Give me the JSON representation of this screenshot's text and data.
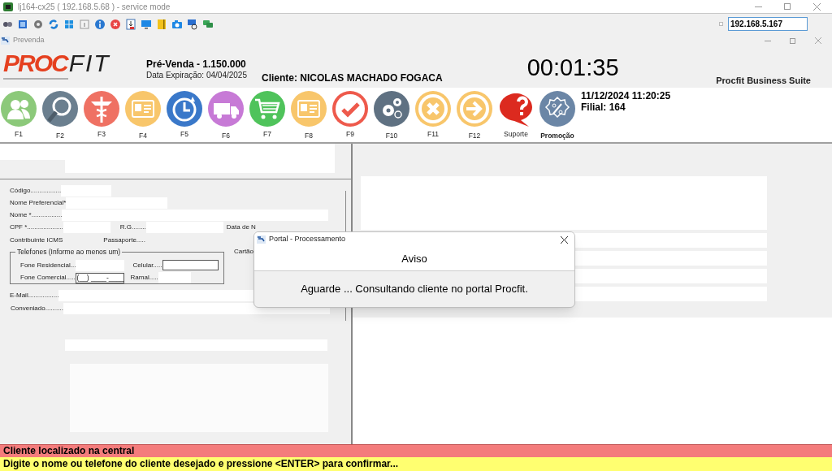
{
  "app_window": {
    "title": "lj164-cx25 ( 192.168.5.68 ) - service mode",
    "address": "192.168.5.167"
  },
  "subwindow": {
    "title": "Prevenda"
  },
  "logo": {
    "left": "PROC",
    "right": "FIT"
  },
  "header": {
    "sale": "Pré-Venda - 1.150.000",
    "expiry": "Data Expiração: 04/04/2025",
    "client": "Cliente: NICOLAS MACHADO FOGACA",
    "timer": "00:01:35",
    "suite": "Procfit Business Suite"
  },
  "function_keys": [
    {
      "label": "F1",
      "kind": "people",
      "color": "#8cc97a"
    },
    {
      "label": "F2",
      "kind": "search",
      "color": "#6b7f8f"
    },
    {
      "label": "F3",
      "kind": "caduceus",
      "color": "#ef7163"
    },
    {
      "label": "F4",
      "kind": "card",
      "color": "#f8c66b"
    },
    {
      "label": "F5",
      "kind": "clock",
      "color": "#3a78c9"
    },
    {
      "label": "F6",
      "kind": "truck",
      "color": "#c77ad6"
    },
    {
      "label": "F7",
      "kind": "cart",
      "color": "#4fc35b"
    },
    {
      "label": "F8",
      "kind": "card",
      "color": "#f8c66b"
    },
    {
      "label": "F9",
      "kind": "check",
      "color": "#ee5a4c"
    },
    {
      "label": "F10",
      "kind": "gears",
      "color": "#5f7182"
    },
    {
      "label": "F11",
      "kind": "cancel",
      "color": "#f8c66b"
    },
    {
      "label": "F12",
      "kind": "arrow",
      "color": "#f8c66b"
    },
    {
      "label": "Suporte",
      "kind": "help",
      "color": "#dc2a1f"
    },
    {
      "label": "Promoção",
      "kind": "percent",
      "color": "#6b86a6"
    }
  ],
  "session": {
    "datetime": "11/12/2024 11:20:25",
    "branch": "Filial: 164"
  },
  "form": {
    "codigo": "Código.................",
    "nome_preferencial": "Nome Preferencial*",
    "nome": "Nome *.................",
    "cpf": "CPF *....................",
    "rg": "R.G........",
    "data_nascimento": "Data de N",
    "contribuinte": "Contribuinte ICMS",
    "passaporte": "Passaporte.....",
    "cartao": "Cartão",
    "telefones": {
      "legend": "Telefones (Informe ao menos um)",
      "residencial": "Fone Residencial...",
      "celular": "Celular.....",
      "comercial": "Fone Comercial.....",
      "comercial_value": "(__) ____-____",
      "ramal": "Ramal....."
    },
    "email": "E-Mail.................",
    "conveniado": "Conveniado.........."
  },
  "dialog": {
    "title": "Portal - Processamento",
    "heading": "Aviso",
    "message": "Aguarde ... Consultando cliente no portal Procfit."
  },
  "status_bar": {
    "message": "Cliente localizado na central",
    "hint": "Digite o nome ou telefone do cliente desejado e pressione <ENTER> para confirmar..."
  }
}
